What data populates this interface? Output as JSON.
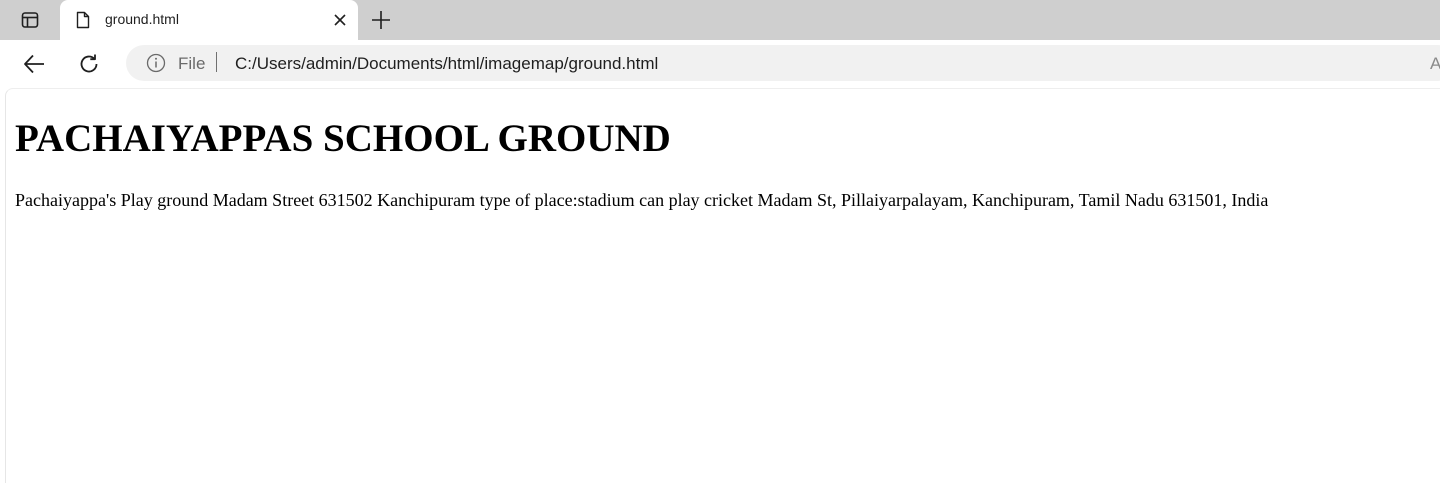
{
  "browser": {
    "tab": {
      "title": "ground.html"
    },
    "address_bar": {
      "scheme_label": "File",
      "url": "C:/Users/admin/Documents/html/imagemap/ground.html",
      "trailing_glyph": "A"
    },
    "icons": {
      "tab_actions": "tab-actions-icon",
      "favicon": "file-icon",
      "close": "close-icon",
      "new_tab": "plus-icon",
      "back": "back-arrow-icon",
      "reload": "reload-icon",
      "site_info": "info-icon"
    }
  },
  "page": {
    "heading": "PACHAIYAPPAS SCHOOL GROUND",
    "paragraph": "Pachaiyappa's Play ground Madam Street 631502 Kanchipuram type of place:stadium can play cricket Madam St, Pillaiyarpalayam, Kanchipuram, Tamil Nadu 631501, India"
  }
}
